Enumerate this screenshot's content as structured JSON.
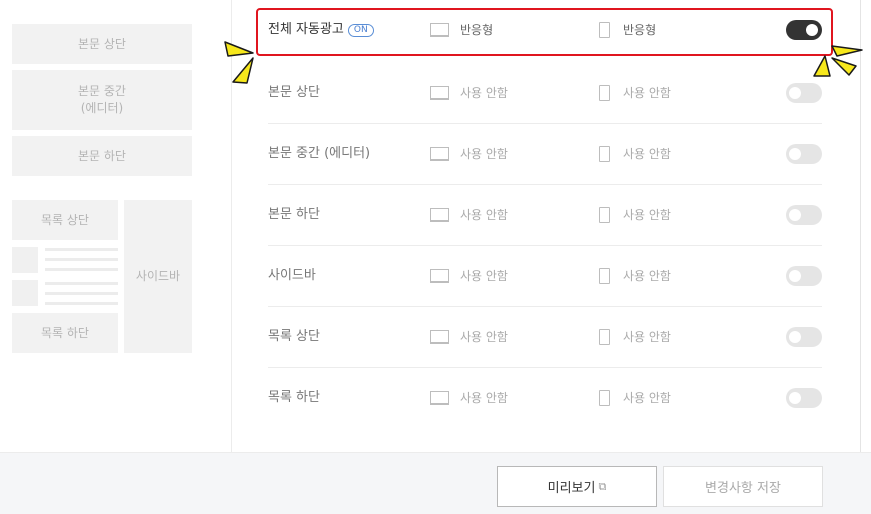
{
  "preview": {
    "body_top": "본문 상단",
    "body_middle": "본문 중간\n(에디터)",
    "body_bottom": "본문 하단",
    "list_top": "목록 상단",
    "list_bottom": "목록 하단",
    "sidebar": "사이드바"
  },
  "rows": [
    {
      "label": "전체 자동광고",
      "badge": "ON",
      "pc": "반응형",
      "mobile": "반응형",
      "enabled": true
    },
    {
      "label": "본문 상단",
      "pc": "사용 안함",
      "mobile": "사용 안함",
      "enabled": false
    },
    {
      "label": "본문 중간 (에디터)",
      "pc": "사용 안함",
      "mobile": "사용 안함",
      "enabled": false
    },
    {
      "label": "본문 하단",
      "pc": "사용 안함",
      "mobile": "사용 안함",
      "enabled": false
    },
    {
      "label": "사이드바",
      "pc": "사용 안함",
      "mobile": "사용 안함",
      "enabled": false
    },
    {
      "label": "목록 상단",
      "pc": "사용 안함",
      "mobile": "사용 안함",
      "enabled": false
    },
    {
      "label": "목록 하단",
      "pc": "사용 안함",
      "mobile": "사용 안함",
      "enabled": false
    }
  ],
  "footer": {
    "preview_button": "미리보기",
    "save_button": "변경사항 저장"
  },
  "icons": {
    "pc": "monitor-icon",
    "mobile": "mobile-phone-icon",
    "external": "external-link-icon"
  },
  "colors": {
    "highlight": "#e0151f",
    "toggle_on": "#333333",
    "toggle_off": "#e5e5e5",
    "badge": "#4a7fd0",
    "spark": "#f7e81c"
  }
}
